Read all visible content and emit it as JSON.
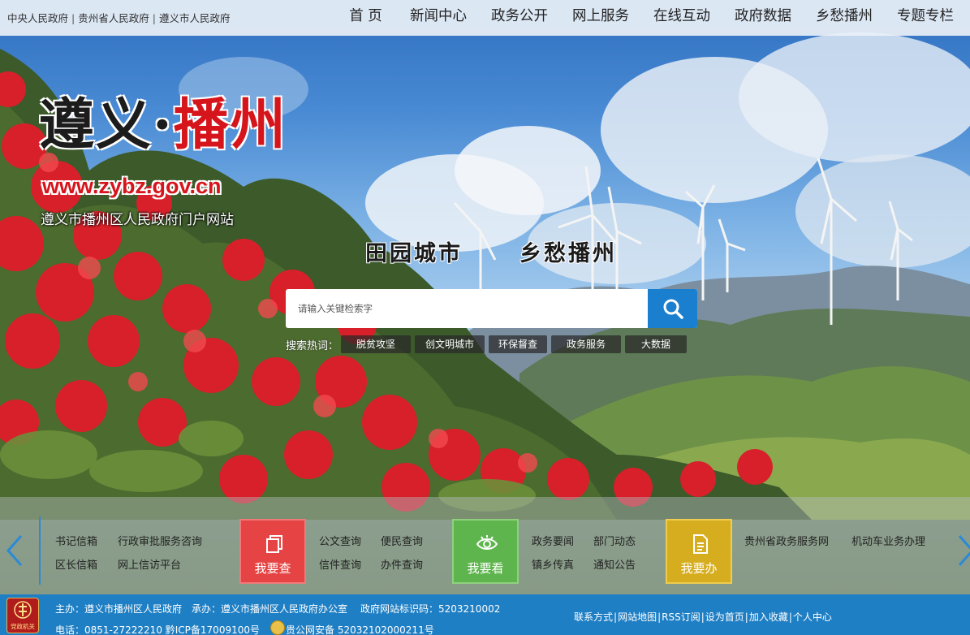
{
  "gov_links": [
    "中央人民政府",
    "贵州省人民政府",
    "遵义市人民政府"
  ],
  "gov_links_separator": "|",
  "nav": [
    "首 页",
    "新闻中心",
    "政务公开",
    "网上服务",
    "在线互动",
    "政府数据",
    "乡愁播州",
    "专题专栏"
  ],
  "logo": {
    "part1": "遵义·",
    "part2": "播州",
    "url": "www.zybz.gov.cn",
    "subtitle": "遵义市播州区人民政府门户网站"
  },
  "slogan": {
    "left": "田园城市",
    "right": "乡愁播州"
  },
  "search": {
    "placeholder": "请输入关键检索字",
    "hot_label": "搜索热词：",
    "hot_tags": [
      "脱贫攻坚",
      "创文明城市",
      "环保督查",
      "政务服务",
      "大数据"
    ]
  },
  "services": {
    "group1": [
      "书记信箱",
      "行政审批服务咨询",
      "区长信箱",
      "网上信访平台"
    ],
    "check_button": "我要查",
    "group2": [
      "公文查询",
      "便民查询",
      "信件查询",
      "办件查询"
    ],
    "view_button": "我要看",
    "group3": [
      "政务要闻",
      "部门动态",
      "镇乡传真",
      "通知公告"
    ],
    "do_button": "我要办",
    "group4": [
      "贵州省政务服务网",
      "机动车业务办理"
    ]
  },
  "colors": {
    "check_button": "#e64444",
    "view_button": "#5fb54d",
    "do_button": "#d6ad1e",
    "footer": "#1f7fc4",
    "logo_red": "#d6141b"
  },
  "footer": {
    "badge": "党政机关",
    "host": "主办：遵义市播州区人民政府",
    "organizer": "承办：遵义市播州区人民政府办公室",
    "site_code": "政府网站标识码：5203210002",
    "phone": "电话：0851-27222210 黔ICP备17009100号",
    "police": "贵公网安备 52032102000211号",
    "links": [
      "联系方式",
      "网站地图",
      "RSS订阅",
      "设为首页",
      "加入收藏",
      "个人中心"
    ]
  }
}
